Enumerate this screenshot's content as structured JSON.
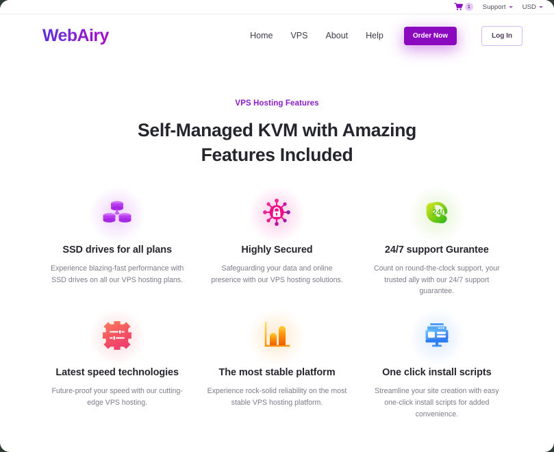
{
  "topbar": {
    "cart_icon": "shopping-cart-icon",
    "cart_count": "1",
    "support_label": "Support",
    "currency_label": "USD"
  },
  "header": {
    "logo_text": "WebAiry",
    "nav": [
      {
        "label": "Home"
      },
      {
        "label": "VPS"
      },
      {
        "label": "About"
      },
      {
        "label": "Help"
      }
    ],
    "order_button": "Order Now",
    "login_button": "Log In"
  },
  "section": {
    "eyebrow": "VPS Hosting Features",
    "headline": "Self-Managed KVM with Amazing Features Included"
  },
  "features": [
    {
      "icon": "ssd-disk-stack-icon",
      "title": "SSD drives for all plans",
      "desc": "Experience blazing-fast performance with SSD drives on all our VPS hosting plans."
    },
    {
      "icon": "security-lock-node-icon",
      "title": "Highly Secured",
      "desc": "Safeguarding your data and online presence with our VPS hosting solutions."
    },
    {
      "icon": "phone-24-7-support-icon",
      "title": "24/7 support Gurantee",
      "desc": "Count on round-the-clock support, your trusted ally with our 24/7 support guarantee."
    },
    {
      "icon": "gear-sliders-icon",
      "title": "Latest speed technologies",
      "desc": "Future-proof your speed with our cutting-edge VPS hosting."
    },
    {
      "icon": "bar-chart-icon",
      "title": "The most stable platform",
      "desc": "Experience rock-solid reliability on the most stable VPS hosting platform."
    },
    {
      "icon": "monitor-screen-icon",
      "title": "One click install scripts",
      "desc": "Streamline your site creation with easy one-click install scripts for added convenience."
    }
  ],
  "colors": {
    "brand_purple": "#8b09be",
    "eyebrow_purple": "#8a19c4",
    "heading_dark": "#25252e",
    "body_gray": "#7c7c8a",
    "icon_ssd": "#b44ff0",
    "icon_security": "#ec0f8a",
    "icon_support": "#6bc40f",
    "icon_gear": "#f4605f",
    "icon_chart": "#fb8b00",
    "icon_monitor": "#2f86f6"
  }
}
